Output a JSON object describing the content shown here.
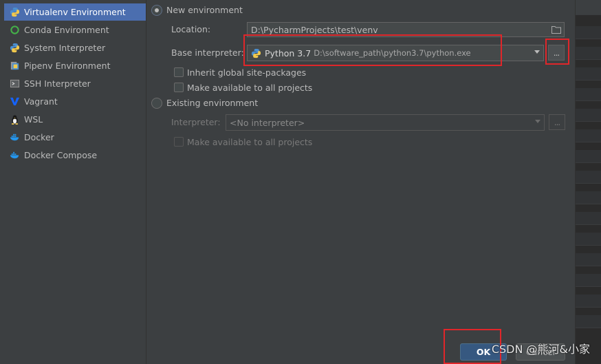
{
  "sidebar": {
    "items": [
      {
        "label": "Virtualenv Environment",
        "icon": "python-venv-icon",
        "selected": true
      },
      {
        "label": "Conda Environment",
        "icon": "conda-icon",
        "selected": false
      },
      {
        "label": "System Interpreter",
        "icon": "python-icon",
        "selected": false
      },
      {
        "label": "Pipenv Environment",
        "icon": "pipenv-icon",
        "selected": false
      },
      {
        "label": "SSH Interpreter",
        "icon": "ssh-terminal-icon",
        "selected": false
      },
      {
        "label": "Vagrant",
        "icon": "vagrant-icon",
        "selected": false
      },
      {
        "label": "WSL",
        "icon": "linux-penguin-icon",
        "selected": false
      },
      {
        "label": "Docker",
        "icon": "docker-icon",
        "selected": false
      },
      {
        "label": "Docker Compose",
        "icon": "docker-compose-icon",
        "selected": false
      }
    ]
  },
  "new_env": {
    "radio_label": "New environment",
    "location_label": "Location:",
    "location_value": "D:\\PycharmProjects\\test\\venv",
    "base_interpreter_label": "Base interpreter:",
    "base_interpreter_name": "Python 3.7",
    "base_interpreter_path": "D:\\software_path\\python3.7\\python.exe",
    "browse_label": "...",
    "inherit_label": "Inherit global site-packages",
    "make_available_label": "Make available to all projects"
  },
  "existing_env": {
    "radio_label": "Existing environment",
    "interpreter_label": "Interpreter:",
    "interpreter_value": "<No interpreter>",
    "browse_label": "...",
    "make_available_label": "Make available to all projects"
  },
  "footer": {
    "ok_label": "OK",
    "cancel_label": "Cancel"
  },
  "watermark": "CSDN @熊河&小家",
  "colors": {
    "selection": "#4b6eaf",
    "highlight_box": "#e0262a",
    "background": "#3c3f41"
  }
}
